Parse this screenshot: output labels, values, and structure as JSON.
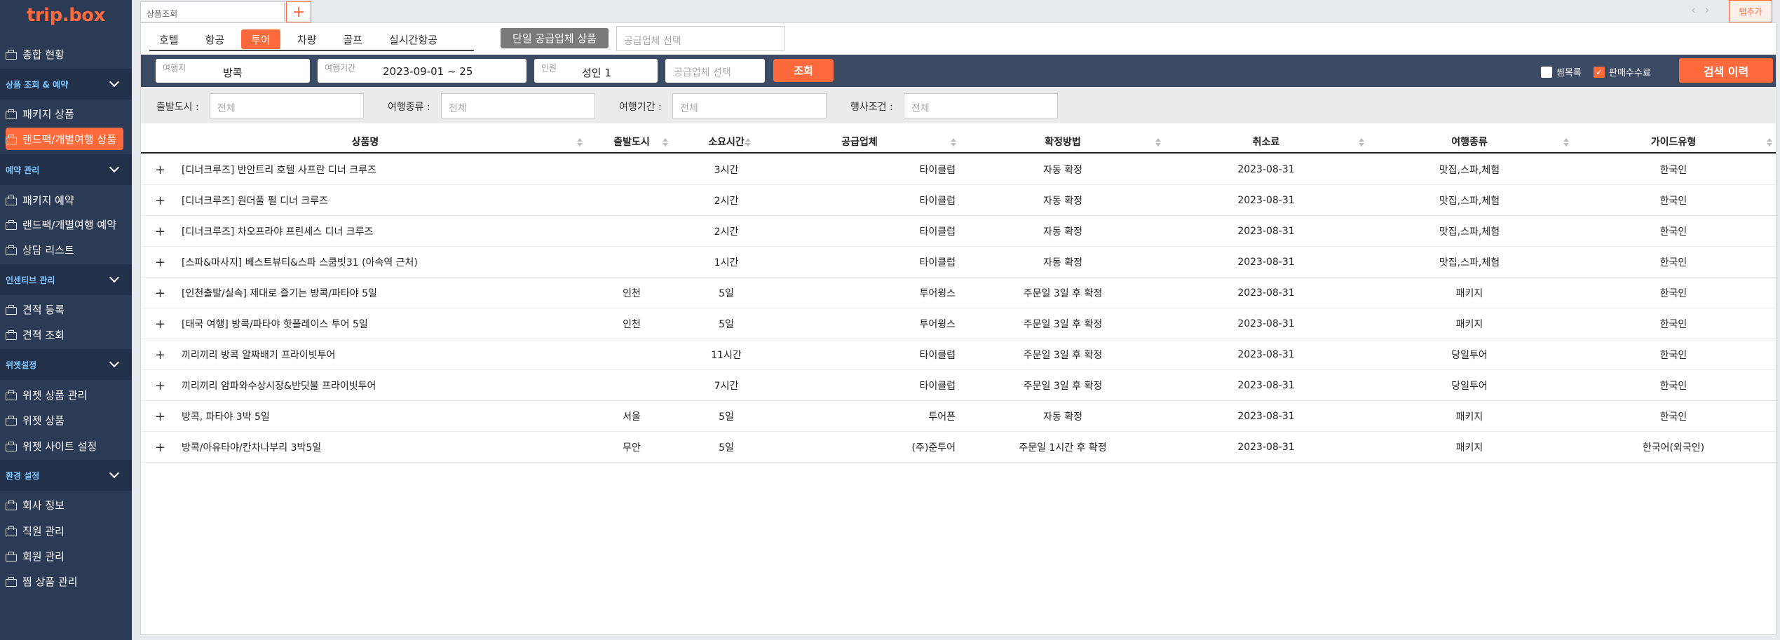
{
  "brand": {
    "logo": "trip.box",
    "accent": "#ff6a3d",
    "sidebar_bg": "#2b3a55"
  },
  "sidebar": {
    "dashboard": "종합 현황",
    "sections": [
      {
        "title": "상품 조회 & 예약",
        "items": [
          "패키지 상품",
          "랜드팩/개별여행 상품"
        ]
      },
      {
        "title": "예약 관리",
        "items": [
          "패키지 예약",
          "랜드팩/개별여행 예약",
          "상담 리스트"
        ]
      },
      {
        "title": "인센티브 관리",
        "items": [
          "견적 등록",
          "견적 조회"
        ]
      },
      {
        "title": "위젯설정",
        "items": [
          "위젯 상품 관리",
          "위젯 상품",
          "위젯 사이트 설정"
        ]
      },
      {
        "title": "환경 설정",
        "items": [
          "회사 정보",
          "직원 관리",
          "회원 관리",
          "찜 상품 관리"
        ]
      }
    ]
  },
  "tabs": {
    "current": "상품조회",
    "add": "+",
    "prev": "‹",
    "next": "›",
    "add_tab_button": "탭추가"
  },
  "categories": [
    "호텔",
    "항공",
    "투어",
    "차량",
    "골프",
    "실시간항공"
  ],
  "single_supplier_button": "단일 공급업체 상품",
  "supplier_select_placeholder": "공급업체 선택",
  "search": {
    "destination_label": "여행지",
    "destination": "방콕",
    "period_label": "여행기간",
    "period": "2023-09-01 ~ 25",
    "pax_label": "인원",
    "pax": "성인 1",
    "supplier_placeholder": "공급업체 선택",
    "search_button": "조회",
    "wishlist_label": "찜목록",
    "wishlist_checked": false,
    "commission_label": "판매수수료",
    "commission_checked": true,
    "history_button": "검색 이력"
  },
  "filters": [
    {
      "label": "출발도시 :",
      "placeholder": "전체"
    },
    {
      "label": "여행종류 :",
      "placeholder": "전체"
    },
    {
      "label": "여행기간 :",
      "placeholder": "전체"
    },
    {
      "label": "행사조건 :",
      "placeholder": "전체"
    }
  ],
  "table": {
    "columns": [
      "상품명",
      "출발도시",
      "소요시간",
      "공급업체",
      "확정방법",
      "취소료",
      "여행종류",
      "가이드유형"
    ],
    "rows": [
      {
        "name": "[디너크루즈] 반안트리 호텔 사프란 디너 크루즈",
        "city": "",
        "duration": "3시간",
        "supplier": "타이클럽",
        "confirm": "자동 확정",
        "cancel": "2023-08-31",
        "type": "맛집,스파,체험",
        "guide": "한국인"
      },
      {
        "name": "[디너크루즈] 원더풀 펄 디너 크루즈",
        "city": "",
        "duration": "2시간",
        "supplier": "타이클럽",
        "confirm": "자동 확정",
        "cancel": "2023-08-31",
        "type": "맛집,스파,체험",
        "guide": "한국인"
      },
      {
        "name": "[디너크루즈] 차오프라야 프린세스 디너 크루즈",
        "city": "",
        "duration": "2시간",
        "supplier": "타이클럽",
        "confirm": "자동 확정",
        "cancel": "2023-08-31",
        "type": "맛집,스파,체험",
        "guide": "한국인"
      },
      {
        "name": "[스파&마사지] 베스트뷰티&스파 스쿰빗31 (아속역 근처)",
        "city": "",
        "duration": "1시간",
        "supplier": "타이클럽",
        "confirm": "자동 확정",
        "cancel": "2023-08-31",
        "type": "맛집,스파,체험",
        "guide": "한국인"
      },
      {
        "name": "[인천출발/실속] 제대로 즐기는 방콕/파타야 5일",
        "city": "인천",
        "duration": "5일",
        "supplier": "투어윙스",
        "confirm": "주문일 3일 후 확정",
        "cancel": "2023-08-31",
        "type": "패키지",
        "guide": "한국인"
      },
      {
        "name": "[태국 여행] 방콕/파타야 핫플레이스 투어 5일",
        "city": "인천",
        "duration": "5일",
        "supplier": "투어윙스",
        "confirm": "주문일 3일 후 확정",
        "cancel": "2023-08-31",
        "type": "패키지",
        "guide": "한국인"
      },
      {
        "name": "끼리끼리 방콕 알짜배기 프라이빗투어",
        "city": "",
        "duration": "11시간",
        "supplier": "타이클럽",
        "confirm": "주문일 3일 후 확정",
        "cancel": "2023-08-31",
        "type": "당일투어",
        "guide": "한국인"
      },
      {
        "name": "끼리끼리 암파와수상시장&반딧불 프라이빗투어",
        "city": "",
        "duration": "7시간",
        "supplier": "타이클럽",
        "confirm": "주문일 3일 후 확정",
        "cancel": "2023-08-31",
        "type": "당일투어",
        "guide": "한국인"
      },
      {
        "name": "방콕, 파타야 3박 5일",
        "city": "서울",
        "duration": "5일",
        "supplier": "투어폰",
        "confirm": "자동 확정",
        "cancel": "2023-08-31",
        "type": "패키지",
        "guide": "한국인"
      },
      {
        "name": "방콕/아유타야/칸차나부리 3박5일",
        "city": "무안",
        "duration": "5일",
        "supplier": "(주)준투어",
        "confirm": "주문일 1시간 후 확정",
        "cancel": "2023-08-31",
        "type": "패키지",
        "guide": "한국어(외국인)"
      }
    ]
  }
}
